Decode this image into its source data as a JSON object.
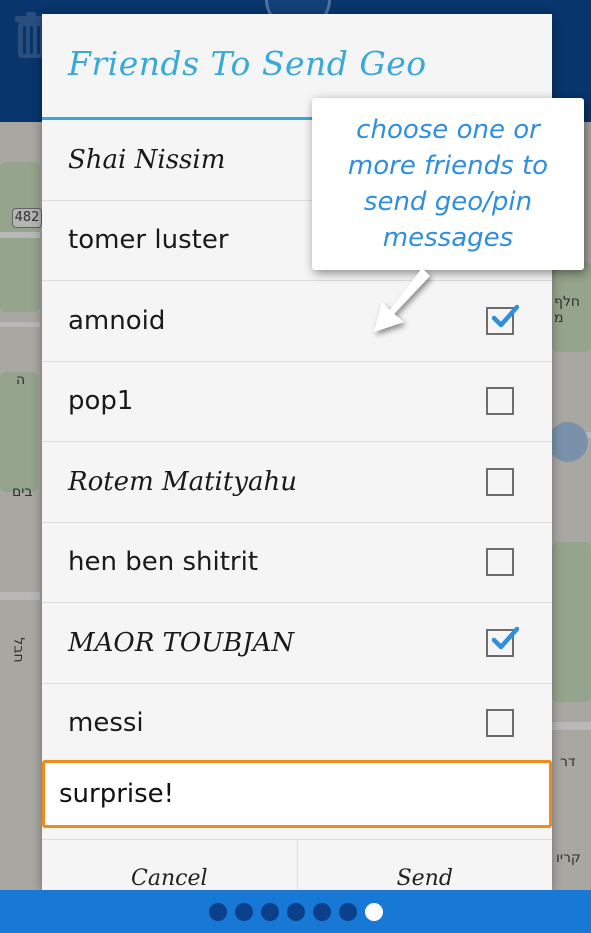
{
  "background": {
    "map_badge": "482",
    "map_labels": [
      "חלף מ",
      "בים",
      "ה",
      "חבל",
      "דר",
      "קריו"
    ]
  },
  "dialog": {
    "title": "Friends To Send Geo",
    "friends": [
      {
        "name": "Shai Nissim",
        "checked": null,
        "style": "script"
      },
      {
        "name": "tomer luster",
        "checked": null,
        "style": "plain"
      },
      {
        "name": "amnoid",
        "checked": true,
        "style": "plain"
      },
      {
        "name": "pop1",
        "checked": false,
        "style": "plain"
      },
      {
        "name": "Rotem Matityahu",
        "checked": false,
        "style": "script"
      },
      {
        "name": "hen ben shitrit",
        "checked": false,
        "style": "plain"
      },
      {
        "name": "MAOR TOUBJAN",
        "checked": true,
        "style": "script"
      },
      {
        "name": "messi",
        "checked": false,
        "style": "plain"
      }
    ],
    "message_value": "surprise!",
    "cancel_label": "Cancel",
    "send_label": "Send"
  },
  "tooltip": {
    "text": "choose one or more friends to send geo/pin messages"
  },
  "pager": {
    "total": 7,
    "active_index": 6
  },
  "colors": {
    "accent": "#39a9d8",
    "checkmark": "#2e8fe0",
    "input_border": "#f08a1c",
    "header": "#0a4a96",
    "pager": "#1878d6"
  },
  "icons": {
    "trash": "trash-icon",
    "check": "check-icon",
    "arrow": "pointer-arrow-icon"
  }
}
